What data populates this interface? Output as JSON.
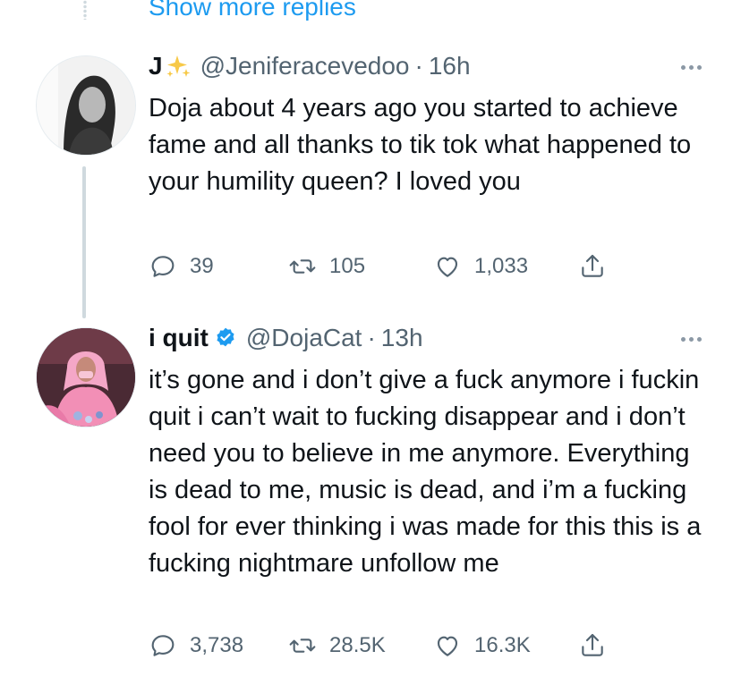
{
  "thread": {
    "show_more_label": "Show more replies"
  },
  "tweets": [
    {
      "display_name": "J",
      "display_name_emoji": "sparkles",
      "handle": "@Jeniferacevedoo",
      "separator": "·",
      "time": "16h",
      "text": "Doja about 4 years ago you started to achieve fame and all thanks to tik tok what happened to your humility queen? I loved you",
      "stats": {
        "replies": "39",
        "retweets": "105",
        "likes": "1,033"
      },
      "verified": false
    },
    {
      "display_name": "i quit",
      "handle": "@DojaCat",
      "separator": "·",
      "time": "13h",
      "text": "it’s gone and i don’t give a fuck anymore i fuckin quit i can’t wait to fucking disappear and i don’t need you to believe in me anymore. Everything is dead to me, music is dead, and i’m a fucking fool for ever thinking i was made for this this is a fucking nightmare unfollow me",
      "stats": {
        "replies": "3,738",
        "retweets": "28.5K",
        "likes": "16.3K"
      },
      "verified": true
    }
  ],
  "colors": {
    "link": "#1d9bf0",
    "muted": "#536471",
    "text": "#0f1419",
    "thread_line": "#cfd9de"
  }
}
